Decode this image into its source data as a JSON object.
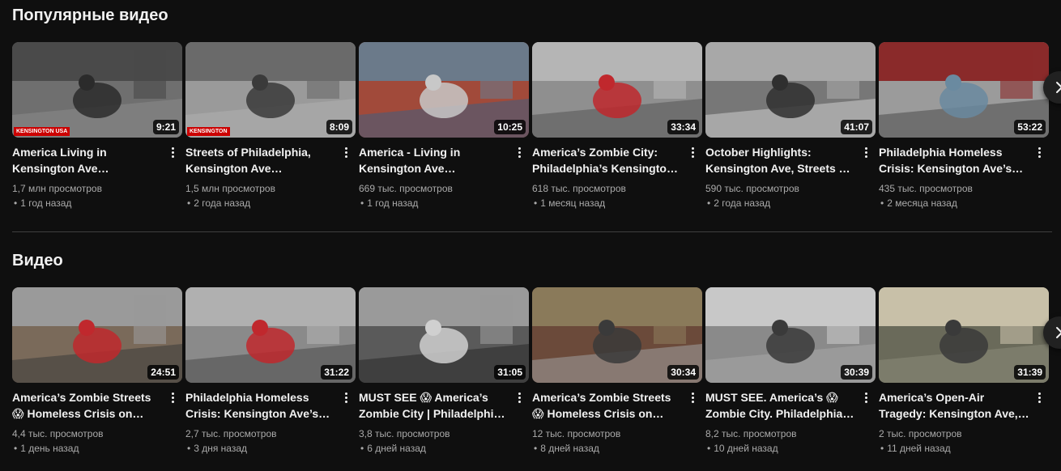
{
  "sections": [
    {
      "title": "Популярные видео",
      "videos": [
        {
          "title": "America Living in Kensington Ave Philadelphia, Streets of Philadelphia",
          "views": "1,7 млн просмотров",
          "age": "1 год назад",
          "duration": "9:21",
          "badge": "KENSINGTON USA"
        },
        {
          "title": "Streets of Philadelphia, Kensington Ave Philadelphia",
          "views": "1,5 млн просмотров",
          "age": "2 года назад",
          "duration": "8:09",
          "badge": "KENSINGTON"
        },
        {
          "title": "America - Living in Kensington Ave Philadelphia",
          "views": "669 тыс. просмотров",
          "age": "1 год назад",
          "duration": "10:25"
        },
        {
          "title": "America’s Zombie City: Philadelphia’s Kensington Ave",
          "views": "618 тыс. просмотров",
          "age": "1 месяц назад",
          "duration": "33:34"
        },
        {
          "title": "October Highlights: Kensington Ave, Streets of Philadelphia",
          "views": "590 тыс. просмотров",
          "age": "2 года назад",
          "duration": "41:07"
        },
        {
          "title": "Philadelphia Homeless Crisis: Kensington Ave’s Streets",
          "views": "435 тыс. просмотров",
          "age": "2 месяца назад",
          "duration": "53:22"
        }
      ]
    },
    {
      "title": "Видео",
      "videos": [
        {
          "title": "America’s Zombie Streets 😱 Homeless Crisis on Kensington Ave",
          "views": "4,4 тыс. просмотров",
          "age": "1 день назад",
          "duration": "24:51"
        },
        {
          "title": "Philadelphia Homeless Crisis: Kensington Ave’s Streets",
          "views": "2,7 тыс. просмотров",
          "age": "3 дня назад",
          "duration": "31:22"
        },
        {
          "title": "MUST SEE 😱 America’s Zombie City | Philadelphia’s Kensington",
          "views": "3,8 тыс. просмотров",
          "age": "6 дней назад",
          "duration": "31:05"
        },
        {
          "title": "America’s Zombie Streets 😱 Homeless Crisis on Kensington Ave",
          "views": "12 тыс. просмотров",
          "age": "8 дней назад",
          "duration": "30:34"
        },
        {
          "title": "MUST SEE. America’s 😱 Zombie City. Philadelphia’s Kensington",
          "views": "8,2 тыс. просмотров",
          "age": "10 дней назад",
          "duration": "30:39"
        },
        {
          "title": "America’s Open-Air Tragedy: Kensington Ave, Philadelphia",
          "views": "2 тыс. просмотров",
          "age": "11 дней назад",
          "duration": "31:39"
        }
      ]
    }
  ],
  "icons": {
    "menu": "kebab-vertical-icon",
    "next": "chevron-right-icon"
  },
  "colors": {
    "background": "#0f0f0f",
    "text": "#f1f1f1",
    "secondary": "#aaaaaa",
    "divider": "#3f3f3f",
    "badge": "#cc0000"
  }
}
